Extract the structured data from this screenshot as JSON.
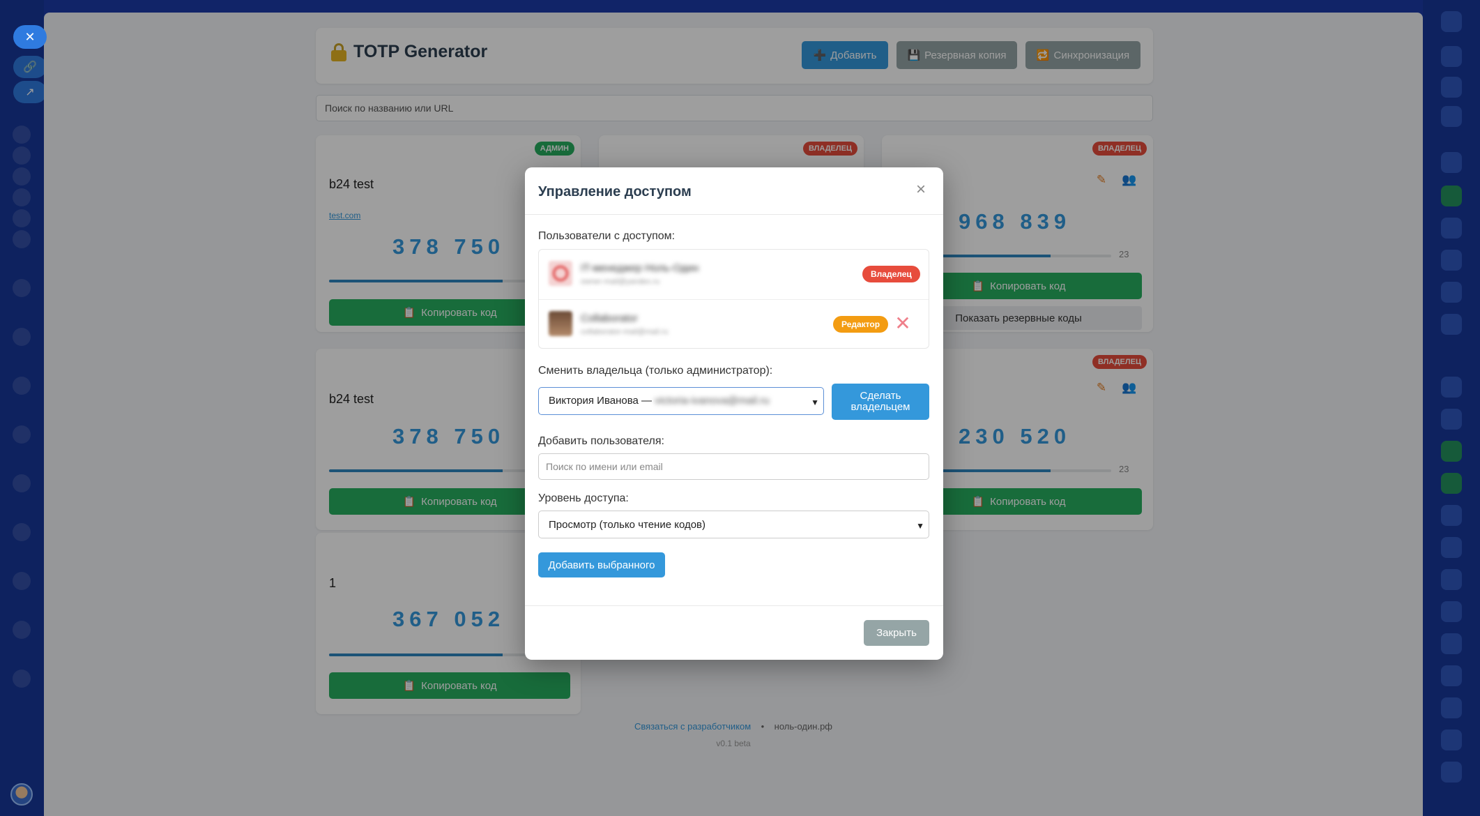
{
  "app": {
    "title": "TOTP Generator",
    "buttons": {
      "add": "Добавить",
      "backup": "Резервная копия",
      "sync": "Синхронизация"
    },
    "search_placeholder": "Поиск по названию или URL"
  },
  "cards": [
    {
      "badge": "АДМИН",
      "title": "b24 test",
      "link": "test.com",
      "code": "378 750",
      "progress": 0.72,
      "copy": "Копировать код"
    },
    {
      "badge": "ВЛАДЕЛЕЦ"
    },
    {
      "badge": "ВЛАДЕЛЕЦ",
      "code": "968 839",
      "progress": 0.72,
      "seconds": "23",
      "copy": "Копировать код",
      "backup_codes": "Показать резервные коды"
    },
    {
      "title": "b24 test",
      "code": "378 750",
      "progress": 0.72,
      "copy": "Копировать код"
    },
    {
      "badge": "ВЛАДЕЛЕЦ",
      "code": "230 520",
      "progress": 0.72,
      "seconds": "23",
      "copy": "Копировать код"
    },
    {
      "title": "1",
      "code": "367 052",
      "progress": 0.72,
      "copy": "Копировать код"
    }
  ],
  "footer": {
    "contact": "Связаться с разработчиком",
    "separator": "•",
    "site": "ноль-один.рф",
    "version": "v0.1 beta"
  },
  "modal": {
    "title": "Управление доступом",
    "users_label": "Пользователи с доступом:",
    "users": [
      {
        "name": "IT-менеджер Ноль-Один",
        "email": "owner-mail@yandex.ru",
        "role": "Владелец"
      },
      {
        "name": "Collaborator",
        "email": "collaborator-mail@mail.ru",
        "role": "Редактор"
      }
    ],
    "change_owner_label": "Сменить владельца (только администратор):",
    "owner_select_value": "Виктория Иванова —",
    "owner_select_hidden": "victoria-ivanova@mail.ru",
    "make_owner_button": "Сделать владельцем",
    "add_user_label": "Добавить пользователя:",
    "add_user_placeholder": "Поиск по имени или email",
    "access_level_label": "Уровень доступа:",
    "access_level_value": "Просмотр (только чтение кодов)",
    "add_selected_button": "Добавить выбранного",
    "close_button": "Закрыть"
  },
  "colors": {
    "primary": "#3498db",
    "success": "#27ae60",
    "danger": "#e74c3c",
    "warning": "#f39c12",
    "muted": "#95a5a6"
  }
}
